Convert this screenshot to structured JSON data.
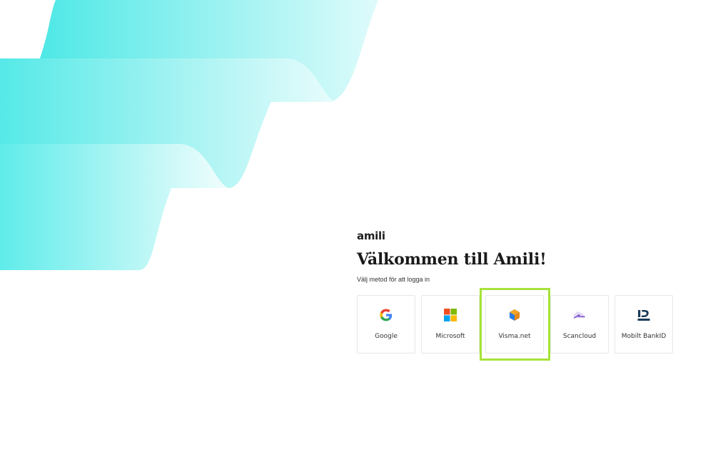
{
  "brand": {
    "logo_text": "amili"
  },
  "login": {
    "title": "Välkommen till Amili!",
    "subtitle": "Välj metod för att logga in",
    "methods": [
      {
        "label": "Google",
        "icon": "google-icon"
      },
      {
        "label": "Microsoft",
        "icon": "microsoft-icon"
      },
      {
        "label": "Visma.net",
        "icon": "visma-icon"
      },
      {
        "label": "Scancloud",
        "icon": "scancloud-icon"
      },
      {
        "label": "Mobilt BankID",
        "icon": "bankid-icon"
      }
    ]
  },
  "colors": {
    "ribbon": "#4ee8e6",
    "highlight": "#a6e33a",
    "title_text": "#1a1a1a"
  }
}
